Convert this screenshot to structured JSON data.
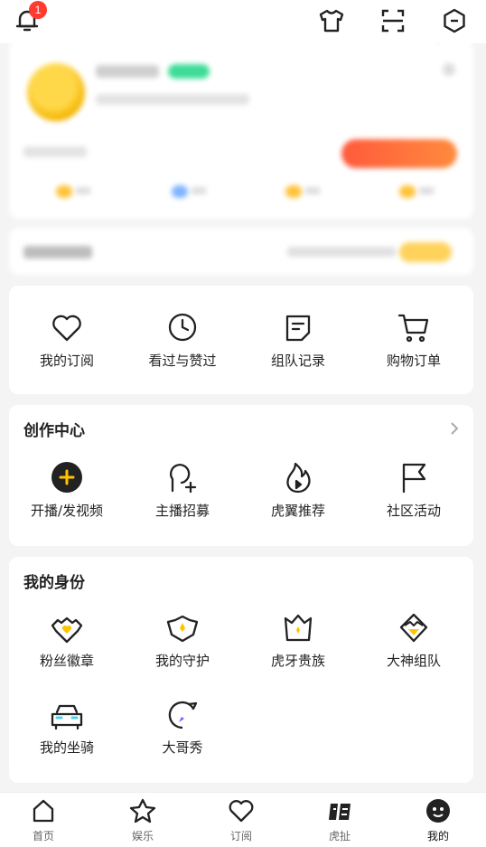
{
  "header": {
    "notification_count": "1",
    "icons": [
      "bell-icon",
      "tshirt-icon",
      "scan-icon",
      "settings-hex-icon"
    ]
  },
  "subscription_grid": {
    "items": [
      {
        "label": "我的订阅",
        "icon": "heart-icon"
      },
      {
        "label": "看过与赞过",
        "icon": "clock-icon"
      },
      {
        "label": "组队记录",
        "icon": "note-icon"
      },
      {
        "label": "购物订单",
        "icon": "cart-icon"
      }
    ]
  },
  "creation_center": {
    "title": "创作中心",
    "items": [
      {
        "label": "开播/发视频",
        "icon": "plus-circle-icon"
      },
      {
        "label": "主播招募",
        "icon": "user-add-icon"
      },
      {
        "label": "虎翼推荐",
        "icon": "flame-icon"
      },
      {
        "label": "社区活动",
        "icon": "flag-icon"
      }
    ]
  },
  "identity": {
    "title": "我的身份",
    "items": [
      {
        "label": "粉丝徽章",
        "icon": "heart-badge-icon"
      },
      {
        "label": "我的守护",
        "icon": "shield-icon"
      },
      {
        "label": "虎牙贵族",
        "icon": "crown-icon"
      },
      {
        "label": "大神组队",
        "icon": "diamond-team-icon"
      },
      {
        "label": "我的坐骑",
        "icon": "car-icon"
      },
      {
        "label": "大哥秀",
        "icon": "bubble-icon"
      }
    ]
  },
  "bottom_nav": {
    "tabs": [
      {
        "label": "首页",
        "icon": "home-icon"
      },
      {
        "label": "娱乐",
        "icon": "star-icon"
      },
      {
        "label": "订阅",
        "icon": "heart-icon"
      },
      {
        "label": "虎扯",
        "icon": "huche-icon"
      },
      {
        "label": "我的",
        "icon": "avatar-icon"
      }
    ],
    "active": "我的"
  },
  "colors": {
    "accent_yellow": "#ffc400",
    "badge_red": "#ff3b30",
    "arrow_red": "#e8222a",
    "icon_dark": "#222222"
  }
}
